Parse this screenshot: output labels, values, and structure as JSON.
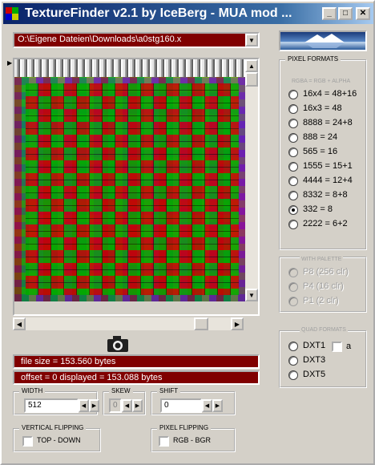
{
  "window": {
    "title": "TextureFinder v2.1 by IceBerg - MUA mod ...",
    "controls": {
      "minimize": "_",
      "maximize": "□",
      "close": "✕"
    }
  },
  "file": {
    "path": "O:\\Eigene Dateien\\Downloads\\a0stg160.x"
  },
  "info": {
    "file_size": "file size = 153.560 bytes",
    "offset_displayed": "offset = 0   displayed = 153.088 bytes"
  },
  "width": {
    "label": "WIDTH",
    "value": "512"
  },
  "skew": {
    "label": "SKEW",
    "value": "0"
  },
  "shift": {
    "label": "SHIFT",
    "value": "0"
  },
  "vertical_flipping": {
    "label": "VERTICAL FLIPPING",
    "option": "TOP - DOWN"
  },
  "pixel_flipping": {
    "label": "PIXEL FLIPPING",
    "option": "RGB  -  BGR"
  },
  "pixel_formats": {
    "label": "PIXEL FORMATS",
    "sub": "RGBA = RGB + ALPHA",
    "items": [
      {
        "label": "16x4 = 48+16",
        "checked": false
      },
      {
        "label": "16x3 = 48",
        "checked": false
      },
      {
        "label": "8888 = 24+8",
        "checked": false
      },
      {
        "label": " 888 = 24",
        "checked": false
      },
      {
        "label": " 565 = 16",
        "checked": false
      },
      {
        "label": "1555 = 15+1",
        "checked": false
      },
      {
        "label": "4444 = 12+4",
        "checked": false
      },
      {
        "label": "8332 = 8+8",
        "checked": false
      },
      {
        "label": " 332 = 8",
        "checked": true
      },
      {
        "label": "2222 = 6+2",
        "checked": false
      }
    ],
    "palette_label": "WITH PALETTE",
    "palette_items": [
      {
        "label": "P8  (256 clr)"
      },
      {
        "label": "P4  (16 clr)"
      },
      {
        "label": "P1  (2 clr)"
      }
    ]
  },
  "quad_formats": {
    "label": "QUAD FORMATS",
    "items": [
      {
        "label": "DXT1"
      },
      {
        "label": "DXT3"
      },
      {
        "label": "DXT5"
      }
    ],
    "alpha_label": "a"
  }
}
